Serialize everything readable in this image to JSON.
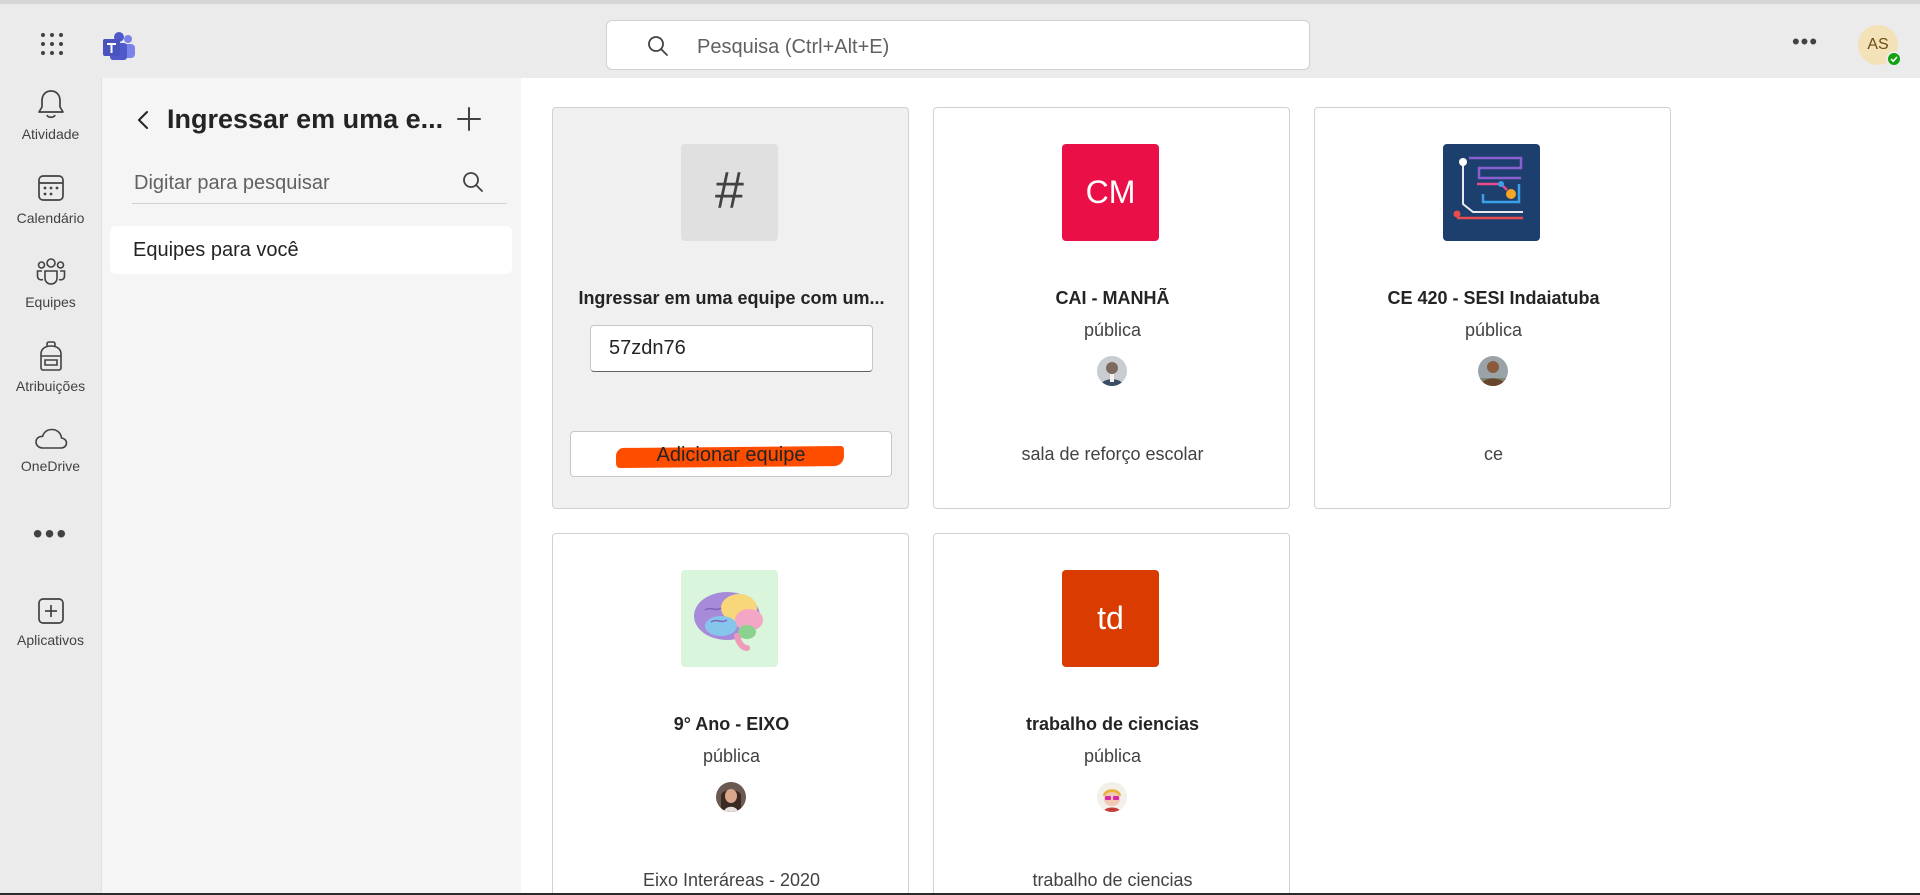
{
  "header": {
    "search_placeholder": "Pesquisa (Ctrl+Alt+E)",
    "more_label": "•••",
    "user_initials": "AS"
  },
  "rail": {
    "items": [
      {
        "label": "Atividade",
        "icon": "bell-icon"
      },
      {
        "label": "Calendário",
        "icon": "calendar-icon"
      },
      {
        "label": "Equipes",
        "icon": "teams-icon"
      },
      {
        "label": "Atribuições",
        "icon": "backpack-icon"
      },
      {
        "label": "OneDrive",
        "icon": "cloud-icon"
      },
      {
        "label": "Aplicativos",
        "icon": "add-apps-icon"
      }
    ],
    "more_label": "•••"
  },
  "pane": {
    "title": "Ingressar em uma e...",
    "search_placeholder": "Digitar para pesquisar",
    "items": [
      {
        "label": "Equipes para você"
      }
    ]
  },
  "join_card": {
    "icon": "#",
    "title": "Ingressar em uma equipe com um...",
    "code_value": "57zdn76",
    "button_label": "Adicionar equipe"
  },
  "teams": [
    {
      "name": "CAI - MANHÃ",
      "visibility": "pública",
      "description": "sala de reforço escolar",
      "initials": "CM",
      "color": "#ea1047"
    },
    {
      "name": "CE 420 - SESI Indaiatuba",
      "visibility": "pública",
      "description": "ce",
      "initials": "",
      "color": "#1c3f6e"
    },
    {
      "name": "9° Ano - EIXO",
      "visibility": "pública",
      "description": "Eixo Interáreas - 2020",
      "initials": "",
      "color": "#d9f5dc"
    },
    {
      "name": "trabalho de ciencias",
      "visibility": "pública",
      "description": "trabalho de ciencias",
      "initials": "td",
      "color": "#da3b01"
    }
  ],
  "colors": {
    "accent": "#5b5fc7",
    "highlight": "#ff4d00"
  }
}
